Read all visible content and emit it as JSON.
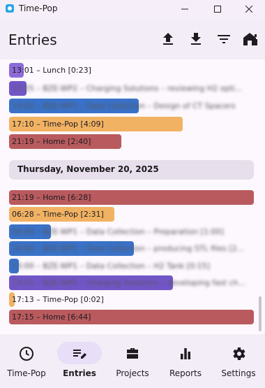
{
  "window": {
    "title": "Time-Pop"
  },
  "appbar": {
    "title": "Entries",
    "actions": [
      "upload-icon",
      "download-icon",
      "filter-icon",
      "home-icon"
    ]
  },
  "colors": {
    "purple": "#8c6ad8",
    "purple_dark": "#7256c9",
    "blue": "#3a72c9",
    "orange": "#f2b263",
    "red": "#b95b5e",
    "header_bg": "#e7e0ec",
    "nav_active": "#e8def8"
  },
  "entries_top": [
    {
      "text": "13:01 – Lunch [0:23]",
      "color": "purple",
      "progress": 0.06,
      "blurred": false
    },
    {
      "text": "13:25 – BZE-WP2 – Charging Solutions – reviewing H2 opti...",
      "color": "purple_dark",
      "progress": 0.07,
      "blurred": true
    },
    {
      "text": "14:03 – BZE-WP1 – Data Collection – Design of CT Spacers",
      "color": "blue",
      "progress": 0.53,
      "blurred": true
    },
    {
      "text": "17:10 – Time-Pop [4:09]",
      "color": "orange",
      "progress": 0.71,
      "blurred": false
    },
    {
      "text": "21:19 – Home [2:40]",
      "color": "red",
      "progress": 0.46,
      "blurred": false
    }
  ],
  "day_header": {
    "label": "Thursday, November 20, 2025"
  },
  "entries_day": [
    {
      "text": "21:19 – Home [6:28]",
      "color": "red",
      "progress": 1.0,
      "blurred": false
    },
    {
      "text": "06:28 – Time-Pop [2:31]",
      "color": "orange",
      "progress": 0.43,
      "blurred": false
    },
    {
      "text": "09:00 – BZE-WP1 – Data Collection – Preparation [1:00]",
      "color": "blue",
      "progress": 0.17,
      "blurred": true
    },
    {
      "text": "10:00 – BZE-WP1 – Data Collection – producing STL files [2...",
      "color": "blue",
      "progress": 0.51,
      "blurred": true
    },
    {
      "text": "13:00 – BZE-WP1 – Data Collection – H2 Tank [0:15]",
      "color": "blue",
      "progress": 0.04,
      "blurred": true
    },
    {
      "text": "13:15 – BZE-WP2 – Charging Solutions – developing fast ch...",
      "color": "purple_dark",
      "progress": 0.67,
      "blurred": true
    },
    {
      "text": "17:13 – Time-Pop [0:02]",
      "color": "orange",
      "progress": 0.01,
      "blurred": false
    },
    {
      "text": "17:15 – Home [6:44]",
      "color": "red",
      "progress": 1.0,
      "blurred": false
    }
  ],
  "nav": [
    {
      "label": "Time-Pop",
      "icon": "clock-icon",
      "active": false
    },
    {
      "label": "Entries",
      "icon": "edit-list-icon",
      "active": true
    },
    {
      "label": "Projects",
      "icon": "briefcase-icon",
      "active": false
    },
    {
      "label": "Reports",
      "icon": "bar-chart-icon",
      "active": false
    },
    {
      "label": "Settings",
      "icon": "gear-icon",
      "active": false
    }
  ]
}
